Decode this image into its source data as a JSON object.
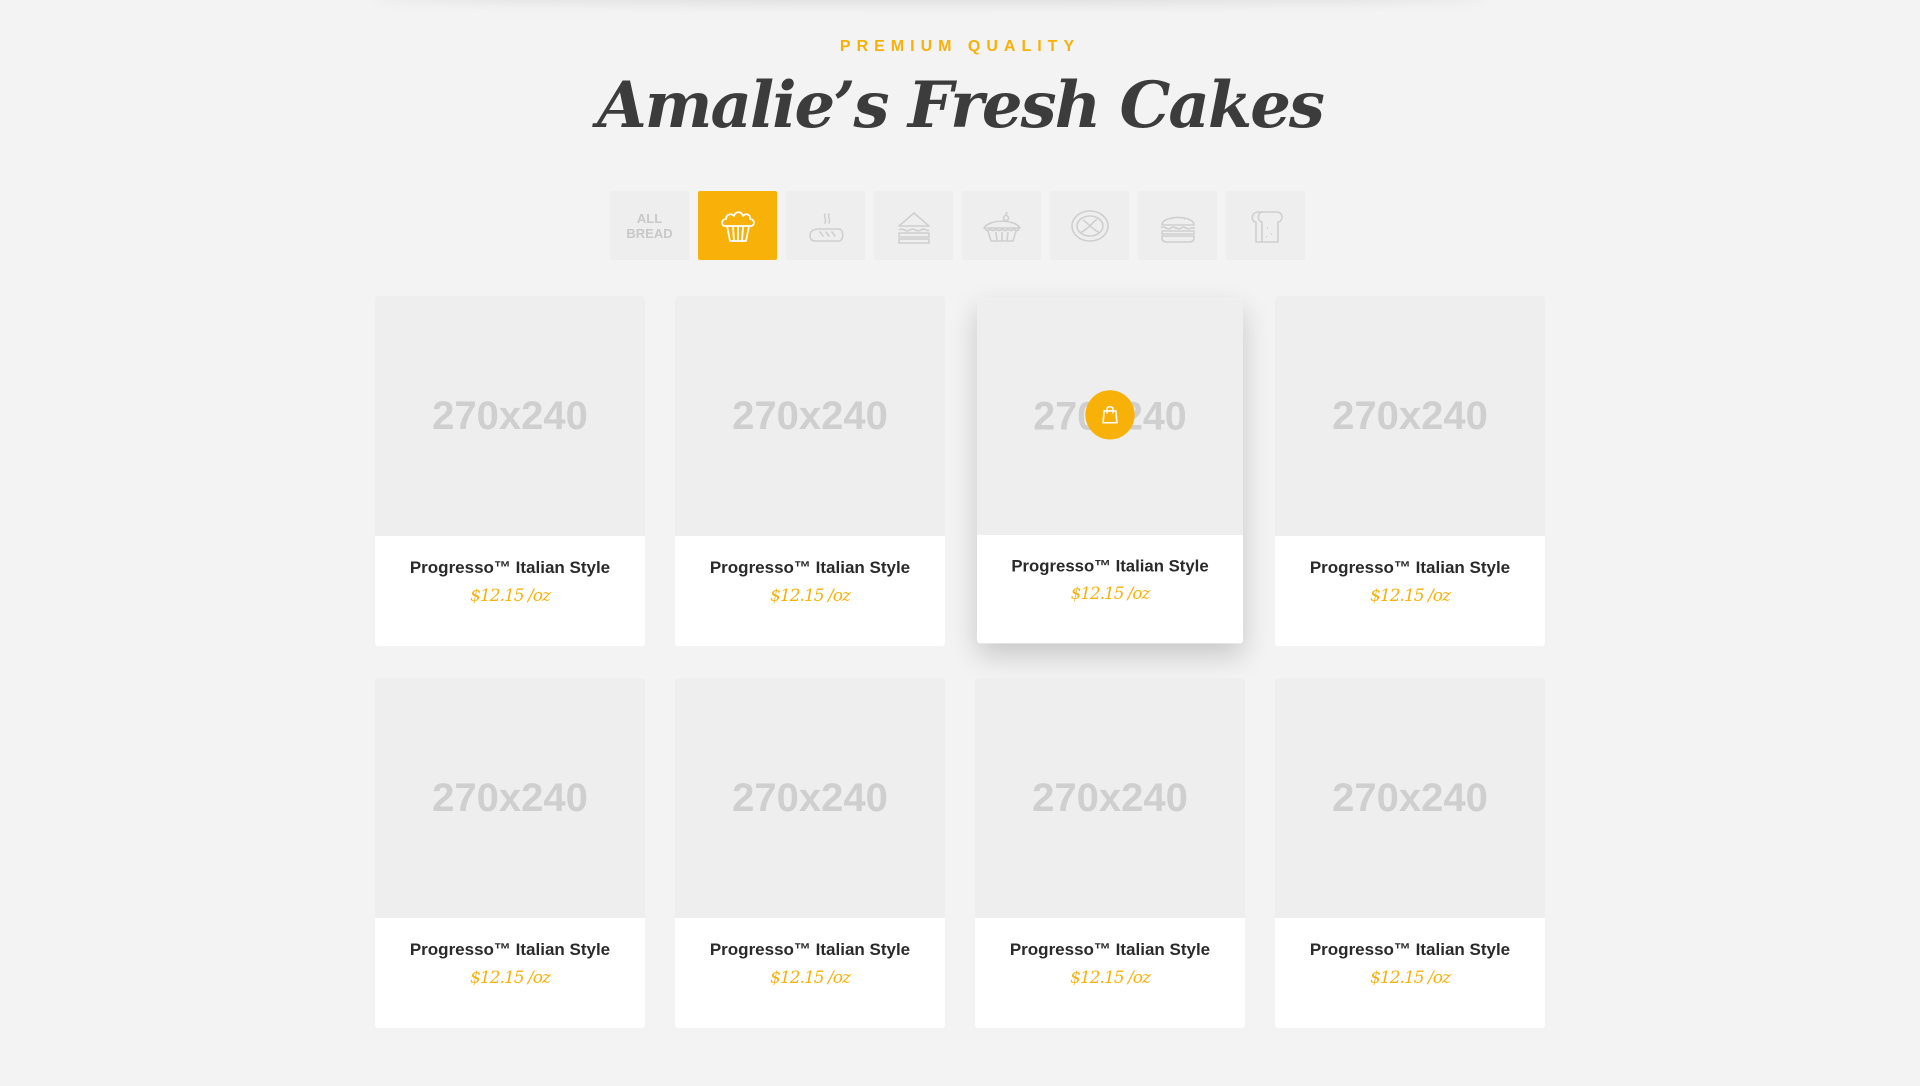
{
  "section": {
    "eyebrow": "PREMIUM QUALITY",
    "title": "Amalie’s Fresh Cakes"
  },
  "filters": [
    {
      "label": "ALL BREAD",
      "icon": "all-bread-text",
      "active": false
    },
    {
      "label": "",
      "icon": "cupcake-icon",
      "active": true
    },
    {
      "label": "",
      "icon": "baguette-icon",
      "active": false
    },
    {
      "label": "",
      "icon": "sandwich-icon",
      "active": false
    },
    {
      "label": "",
      "icon": "pie-icon",
      "active": false
    },
    {
      "label": "",
      "icon": "pretzel-icon",
      "active": false
    },
    {
      "label": "",
      "icon": "burger-icon",
      "active": false
    },
    {
      "label": "",
      "icon": "toast-icon",
      "active": false
    }
  ],
  "products": [
    {
      "image": "270x240",
      "name": "Progresso™ Italian Style",
      "price": "$12.15 /oz"
    },
    {
      "image": "270x240",
      "name": "Progresso™ Italian Style",
      "price": "$12.15 /oz"
    },
    {
      "image": "270x240",
      "name": "Progresso™ Italian Style",
      "price": "$12.15 /oz",
      "hovered": true,
      "action_icon": "shopping-bag-icon"
    },
    {
      "image": "270x240",
      "name": "Progresso™ Italian Style",
      "price": "$12.15 /oz"
    },
    {
      "image": "270x240",
      "name": "Progresso™ Italian Style",
      "price": "$12.15 /oz"
    },
    {
      "image": "270x240",
      "name": "Progresso™ Italian Style",
      "price": "$12.15 /oz"
    },
    {
      "image": "270x240",
      "name": "Progresso™ Italian Style",
      "price": "$12.15 /oz"
    },
    {
      "image": "270x240",
      "name": "Progresso™ Italian Style",
      "price": "$12.15 /oz"
    }
  ],
  "colors": {
    "accent": "#f8b109",
    "background": "#f3f3f3",
    "tile": "#eeeeee",
    "heading": "#3c3c3c"
  }
}
